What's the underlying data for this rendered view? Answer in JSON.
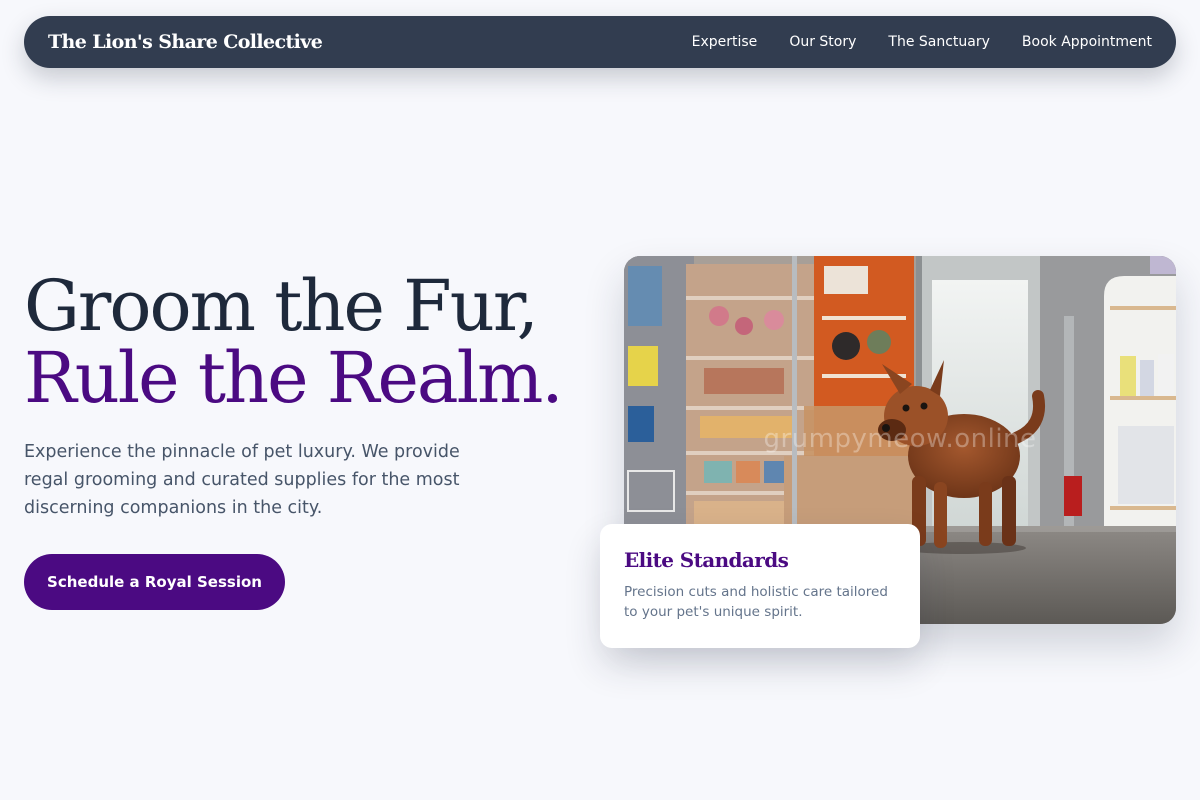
{
  "nav": {
    "brand": "The Lion's Share Collective",
    "links": [
      "Expertise",
      "Our Story",
      "The Sanctuary",
      "Book Appointment"
    ]
  },
  "hero": {
    "title_line1": "Groom the Fur,",
    "title_line2": "Rule the Realm.",
    "subtitle": "Experience the pinnacle of pet luxury. We provide regal grooming and curated supplies for the most discerning companions in the city.",
    "cta_label": "Schedule a Royal Session",
    "image_watermark": "grumpymeow.online"
  },
  "card": {
    "title": "Elite Standards",
    "text": "Precision cuts and holistic care tailored to your pet's unique spirit."
  },
  "colors": {
    "nav_bg": "#323d50",
    "accent_purple": "#4b0a82",
    "heading_dark": "#1e293b",
    "body_text": "#475569",
    "page_bg": "#f7f8fc"
  }
}
